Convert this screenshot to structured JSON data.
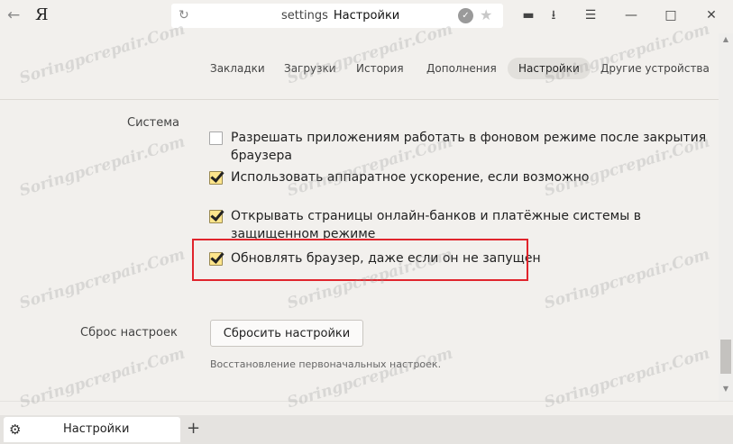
{
  "browser": {
    "logo": "Я",
    "url_host": "settings",
    "url_title": "Настройки"
  },
  "nav_tabs": [
    "Закладки",
    "Загрузки",
    "История",
    "Дополнения",
    "Настройки",
    "Другие устройства"
  ],
  "active_nav": "Настройки",
  "settings": {
    "system_label": "Система",
    "options": [
      {
        "label": "Разрешать приложениям работать в фоновом режиме после закрытия браузера",
        "checked": false
      },
      {
        "label": "Использовать аппаратное ускорение, если возможно",
        "checked": true
      },
      {
        "label": "Открывать страницы онлайн-банков и платёжные системы в защищенном режиме",
        "checked": true
      },
      {
        "label": "Обновлять браузер, даже если он не запущен",
        "checked": true
      }
    ],
    "reset_section_label": "Сброс настроек",
    "reset_button_label": "Сбросить настройки",
    "reset_hint": "Восстановление первоначальных настроек."
  },
  "tab": {
    "title": "Настройки"
  },
  "watermark": "Soringpcrepair.Com",
  "colors": {
    "highlight_border": "#e0242c",
    "checkbox_checked": "#fde58c"
  }
}
